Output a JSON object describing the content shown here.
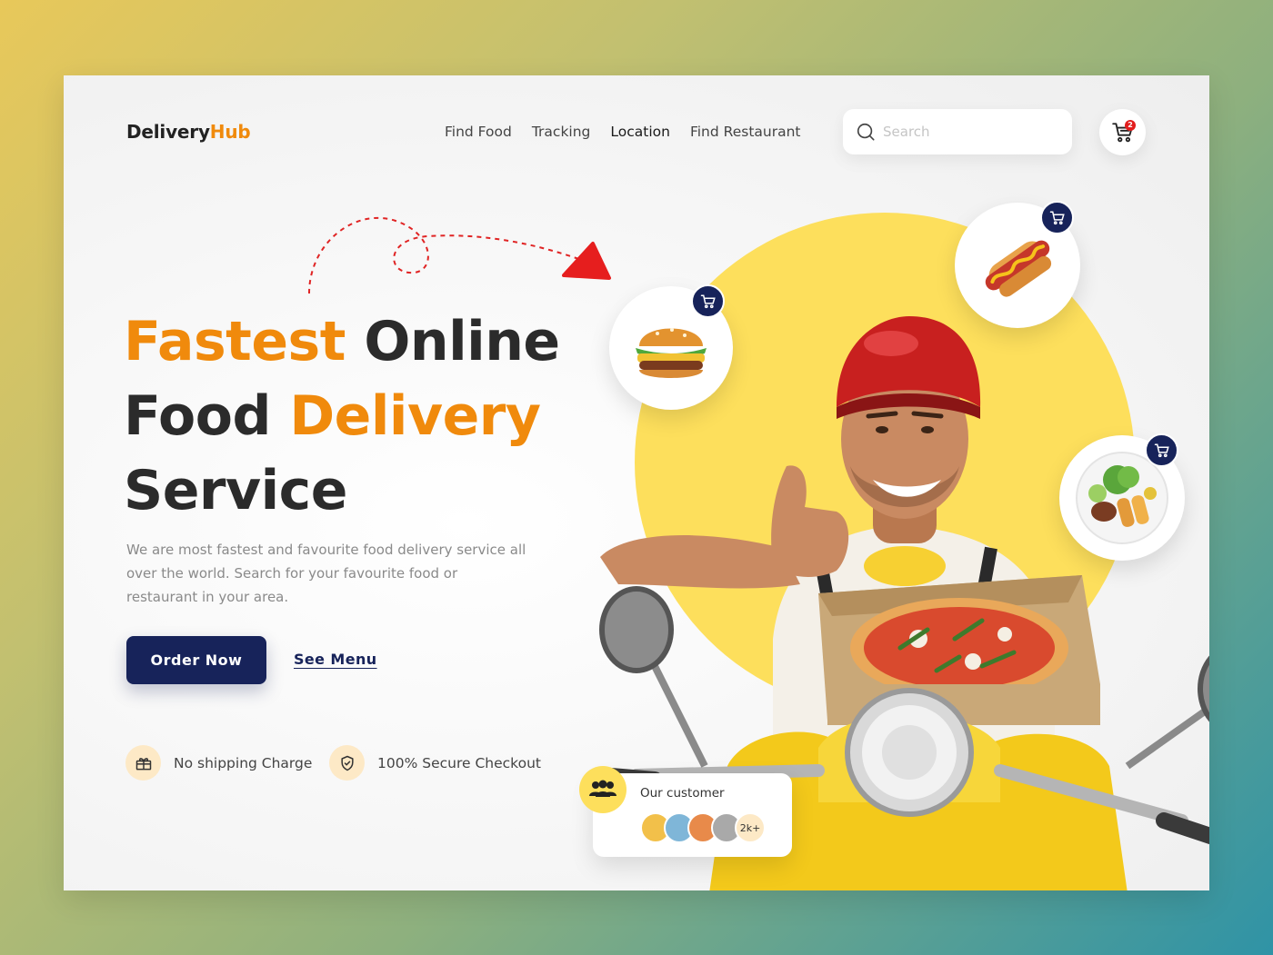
{
  "brand": {
    "name_part1": "Delivery",
    "name_part2": "Hub"
  },
  "nav": {
    "items": [
      {
        "label": "Find Food"
      },
      {
        "label": "Tracking"
      },
      {
        "label": "Location"
      },
      {
        "label": "Find Restaurant"
      }
    ]
  },
  "search": {
    "placeholder": "Search"
  },
  "cart": {
    "count": "2"
  },
  "hero": {
    "line1_highlight": "Fastest",
    "line1_rest": " Online",
    "line2_start": "Food ",
    "line2_highlight": "Delivery",
    "line3": "Service",
    "description": "We are most fastest and favourite food delivery service all over the world. Search for your favourite food or restaurant in your area.",
    "order_button": "Order Now",
    "menu_link": "See Menu"
  },
  "features": [
    {
      "label": "No shipping Charge",
      "icon": "gift-box-icon"
    },
    {
      "label": "100% Secure Checkout",
      "icon": "shield-check-icon"
    }
  ],
  "food_items": [
    {
      "name": "burger",
      "icon": "burger-icon"
    },
    {
      "name": "hot dog",
      "icon": "hotdog-icon"
    },
    {
      "name": "salad plate",
      "icon": "salad-plate-icon"
    }
  ],
  "customers": {
    "label": "Our customer",
    "count": "2k+"
  },
  "colors": {
    "accent": "#f08a0c",
    "navy": "#17235a",
    "yellow": "#fddf5c"
  }
}
